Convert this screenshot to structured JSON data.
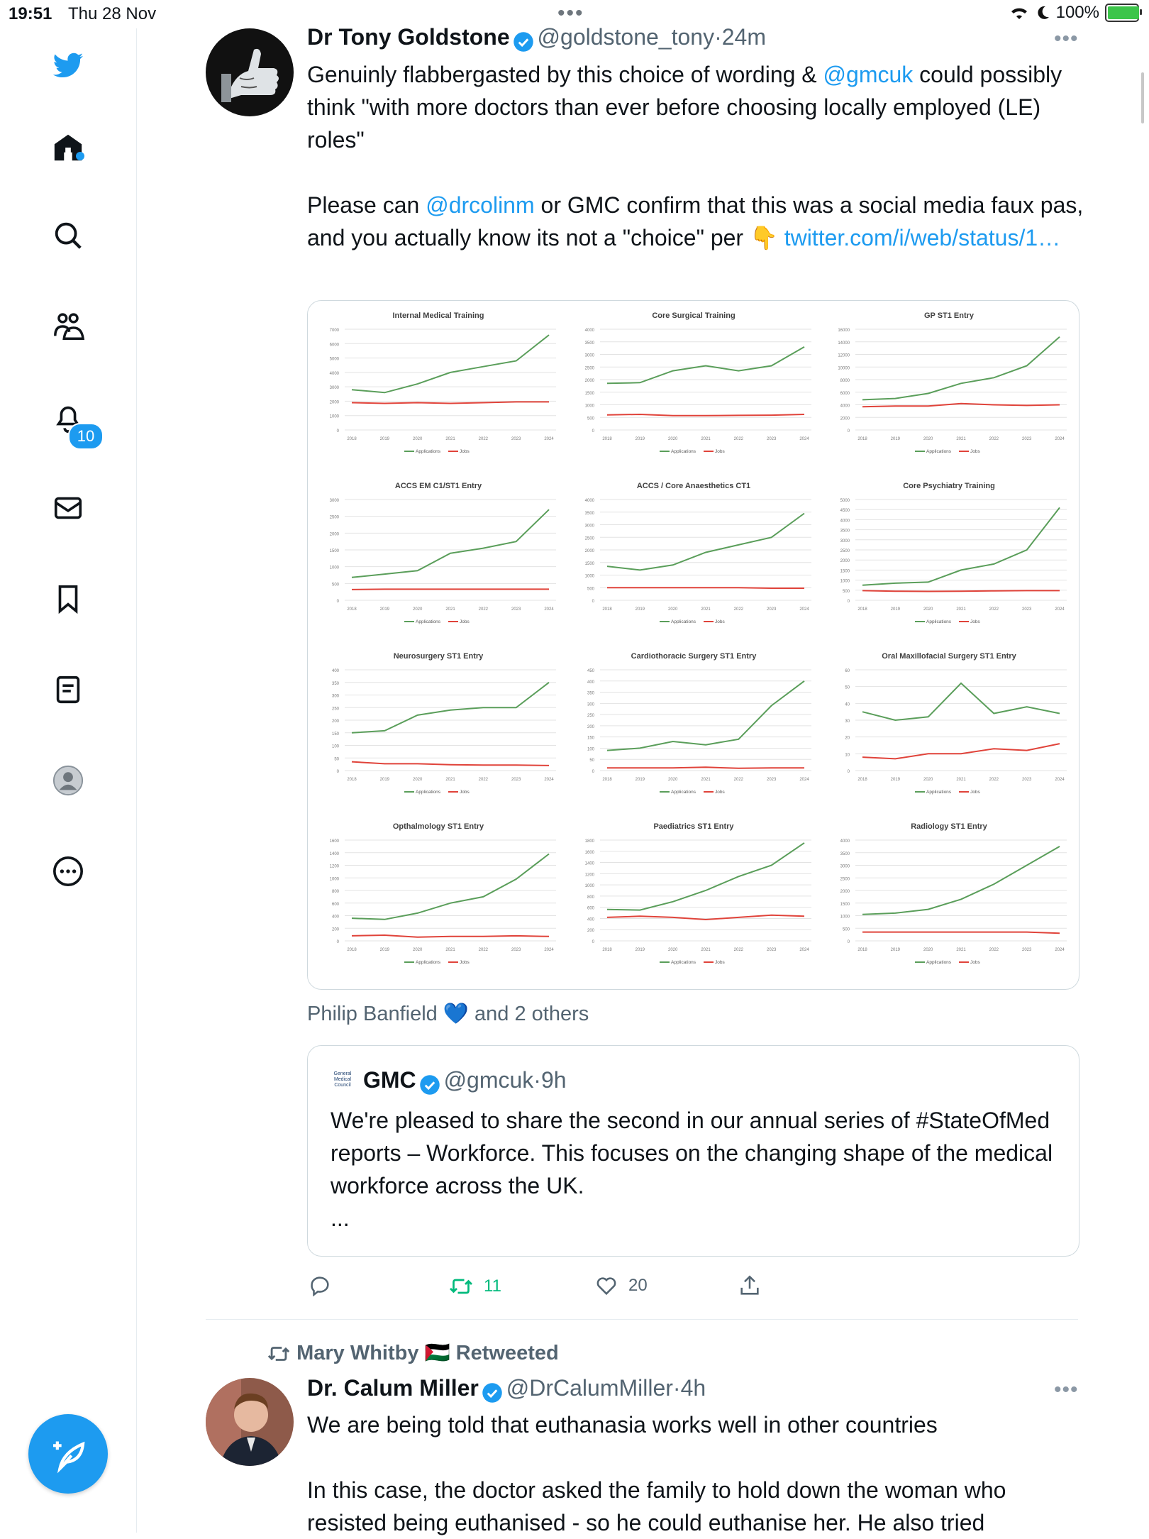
{
  "status": {
    "time": "19:51",
    "date": "Thu 28 Nov",
    "battery": "100%",
    "battery_level": 1.0
  },
  "sidebar": {
    "notif_count": "10"
  },
  "tweet1": {
    "name": "Dr Tony Goldstone",
    "handle": "@goldstone_tony",
    "dot": "·",
    "time": "24m",
    "line1_pre": "Genuinly flabbergasted by this choice of wording & ",
    "mention1": "@gmcuk",
    "line1_post": " could possibly think \"with more doctors than ever before choosing locally employed (LE)  roles\"",
    "line2_pre": "Please can ",
    "mention2": "@drcolinm",
    "line2_mid": " or GMC confirm that this was a social media faux pas, and you actually know its not a \"choice\" per ",
    "emoji": "👇",
    "link": "twitter.com/i/web/status/1…",
    "liked_by": "Philip Banfield",
    "heart": "💙",
    "liked_others": "and 2 others",
    "retweets": "11",
    "likes": "20"
  },
  "quote": {
    "logo_lines": [
      "General",
      "Medical",
      "Council"
    ],
    "name": "GMC",
    "handle": "@gmcuk",
    "dot": "·",
    "time": "9h",
    "text": "We're pleased to share the second in our annual series of #StateOfMed reports – Workforce. This focuses on the changing shape of the medical workforce across the UK.",
    "ellipsis": "..."
  },
  "tweet2": {
    "retweeter": "Mary Whitby",
    "flag": "🇵🇸",
    "retweeted": "Retweeted",
    "name": "Dr. Calum Miller",
    "handle": "@DrCalumMiller",
    "dot": "·",
    "time": "4h",
    "p1": "We are being told that euthanasia works well in other countries",
    "p2": "In this case, the doctor asked the family to hold down the woman who resisted being euthanised - so he could euthanise her. He also tried"
  },
  "colors": {
    "accent": "#1d9bf0",
    "applications": "#5a9e5a",
    "jobs": "#e0433a"
  },
  "chart_data": [
    {
      "type": "line",
      "title": "Internal Medical Training",
      "x": [
        "2018",
        "2019",
        "2020",
        "2021",
        "2022",
        "2023",
        "2024"
      ],
      "ylim": [
        0,
        7000
      ],
      "yticks": [
        "0",
        "1000",
        "2000",
        "3000",
        "4000",
        "5000",
        "6000",
        "7000"
      ],
      "series": [
        {
          "name": "Applications",
          "values": [
            2800,
            2600,
            3200,
            4000,
            4400,
            4800,
            6600
          ]
        },
        {
          "name": "Jobs",
          "values": [
            1900,
            1850,
            1900,
            1850,
            1900,
            1950,
            1950
          ]
        }
      ]
    },
    {
      "type": "line",
      "title": "Core Surgical Training",
      "x": [
        "2018",
        "2019",
        "2020",
        "2021",
        "2022",
        "2023",
        "2024"
      ],
      "ylim": [
        0,
        4000
      ],
      "yticks": [
        "0",
        "500",
        "1000",
        "1500",
        "2000",
        "2500",
        "3000",
        "3500",
        "4000"
      ],
      "series": [
        {
          "name": "Applications",
          "values": [
            1850,
            1880,
            2350,
            2550,
            2350,
            2550,
            3300
          ]
        },
        {
          "name": "Jobs",
          "values": [
            600,
            620,
            570,
            570,
            580,
            590,
            620
          ]
        }
      ]
    },
    {
      "type": "line",
      "title": "GP ST1 Entry",
      "x": [
        "2018",
        "2019",
        "2020",
        "2021",
        "2022",
        "2023",
        "2024"
      ],
      "ylim": [
        0,
        16000
      ],
      "yticks": [
        "0",
        "2000",
        "4000",
        "6000",
        "8000",
        "10000",
        "12000",
        "14000",
        "16000"
      ],
      "series": [
        {
          "name": "Applications",
          "values": [
            4800,
            5000,
            5800,
            7400,
            8300,
            10200,
            14800
          ]
        },
        {
          "name": "Jobs",
          "values": [
            3700,
            3800,
            3800,
            4200,
            4000,
            3900,
            4000
          ]
        }
      ]
    },
    {
      "type": "line",
      "title": "ACCS EM C1/ST1 Entry",
      "x": [
        "2018",
        "2019",
        "2020",
        "2021",
        "2022",
        "2023",
        "2024"
      ],
      "ylim": [
        0,
        3000
      ],
      "yticks": [
        "0",
        "500",
        "1000",
        "1500",
        "2000",
        "2500",
        "3000"
      ],
      "series": [
        {
          "name": "Applications",
          "values": [
            680,
            780,
            880,
            1400,
            1550,
            1750,
            2700
          ]
        },
        {
          "name": "Jobs",
          "values": [
            320,
            330,
            330,
            330,
            330,
            330,
            330
          ]
        }
      ]
    },
    {
      "type": "line",
      "title": "ACCS / Core Anaesthetics CT1",
      "x": [
        "2018",
        "2019",
        "2020",
        "2021",
        "2022",
        "2023",
        "2024"
      ],
      "ylim": [
        0,
        4000
      ],
      "yticks": [
        "0",
        "500",
        "1000",
        "1500",
        "2000",
        "2500",
        "3000",
        "3500",
        "4000"
      ],
      "series": [
        {
          "name": "Applications",
          "values": [
            1350,
            1200,
            1400,
            1900,
            2200,
            2500,
            3450
          ]
        },
        {
          "name": "Jobs",
          "values": [
            500,
            500,
            500,
            500,
            500,
            480,
            480
          ]
        }
      ]
    },
    {
      "type": "line",
      "title": "Core Psychiatry Training",
      "x": [
        "2018",
        "2019",
        "2020",
        "2021",
        "2022",
        "2023",
        "2024"
      ],
      "ylim": [
        0,
        5000
      ],
      "yticks": [
        "0",
        "500",
        "1000",
        "1500",
        "2000",
        "2500",
        "3000",
        "3500",
        "4000",
        "4500",
        "5000"
      ],
      "series": [
        {
          "name": "Applications",
          "values": [
            750,
            850,
            900,
            1500,
            1800,
            2500,
            4600
          ]
        },
        {
          "name": "Jobs",
          "values": [
            480,
            450,
            440,
            450,
            470,
            480,
            480
          ]
        }
      ]
    },
    {
      "type": "line",
      "title": "Neurosurgery ST1 Entry",
      "x": [
        "2018",
        "2019",
        "2020",
        "2021",
        "2022",
        "2023",
        "2024"
      ],
      "ylim": [
        0,
        400
      ],
      "yticks": [
        "0",
        "50",
        "100",
        "150",
        "200",
        "250",
        "300",
        "350",
        "400"
      ],
      "series": [
        {
          "name": "Applications",
          "values": [
            150,
            158,
            220,
            240,
            250,
            250,
            350
          ]
        },
        {
          "name": "Jobs",
          "values": [
            35,
            27,
            27,
            23,
            22,
            22,
            20
          ]
        }
      ]
    },
    {
      "type": "line",
      "title": "Cardiothoracic Surgery ST1 Entry",
      "x": [
        "2018",
        "2019",
        "2020",
        "2021",
        "2022",
        "2023",
        "2024"
      ],
      "ylim": [
        0,
        450
      ],
      "yticks": [
        "0",
        "50",
        "100",
        "150",
        "200",
        "250",
        "300",
        "350",
        "400",
        "450"
      ],
      "series": [
        {
          "name": "Applications",
          "values": [
            90,
            100,
            130,
            115,
            140,
            290,
            400
          ]
        },
        {
          "name": "Jobs",
          "values": [
            12,
            12,
            12,
            15,
            10,
            12,
            12
          ]
        }
      ]
    },
    {
      "type": "line",
      "title": "Oral Maxillofacial Surgery ST1 Entry",
      "x": [
        "2018",
        "2019",
        "2020",
        "2021",
        "2022",
        "2023",
        "2024"
      ],
      "ylim": [
        0,
        60
      ],
      "yticks": [
        "0",
        "10",
        "20",
        "30",
        "40",
        "50",
        "60"
      ],
      "series": [
        {
          "name": "Applications",
          "values": [
            35,
            30,
            32,
            52,
            34,
            38,
            34
          ]
        },
        {
          "name": "Jobs",
          "values": [
            8,
            7,
            10,
            10,
            13,
            12,
            16
          ]
        }
      ]
    },
    {
      "type": "line",
      "title": "Opthalmology ST1 Entry",
      "x": [
        "2018",
        "2019",
        "2020",
        "2021",
        "2022",
        "2023",
        "2024"
      ],
      "ylim": [
        0,
        1600
      ],
      "yticks": [
        "0",
        "200",
        "400",
        "600",
        "800",
        "1000",
        "1200",
        "1400",
        "1600"
      ],
      "series": [
        {
          "name": "Applications",
          "values": [
            360,
            340,
            440,
            600,
            700,
            980,
            1380
          ]
        },
        {
          "name": "Jobs",
          "values": [
            80,
            90,
            60,
            70,
            70,
            80,
            70
          ]
        }
      ]
    },
    {
      "type": "line",
      "title": "Paediatrics ST1 Entry",
      "x": [
        "2018",
        "2019",
        "2020",
        "2021",
        "2022",
        "2023",
        "2024"
      ],
      "ylim": [
        0,
        1800
      ],
      "yticks": [
        "0",
        "200",
        "400",
        "600",
        "800",
        "1000",
        "1200",
        "1400",
        "1600",
        "1800"
      ],
      "series": [
        {
          "name": "Applications",
          "values": [
            560,
            550,
            700,
            900,
            1150,
            1350,
            1750
          ]
        },
        {
          "name": "Jobs",
          "values": [
            420,
            440,
            420,
            380,
            420,
            460,
            440
          ]
        }
      ]
    },
    {
      "type": "line",
      "title": "Radiology ST1 Entry",
      "x": [
        "2018",
        "2019",
        "2020",
        "2021",
        "2022",
        "2023",
        "2024"
      ],
      "ylim": [
        0,
        4000
      ],
      "yticks": [
        "0",
        "500",
        "1000",
        "1500",
        "2000",
        "2500",
        "3000",
        "3500",
        "4000"
      ],
      "series": [
        {
          "name": "Applications",
          "values": [
            1050,
            1100,
            1250,
            1650,
            2250,
            3000,
            3750
          ]
        },
        {
          "name": "Jobs",
          "values": [
            350,
            350,
            350,
            350,
            350,
            350,
            300
          ]
        }
      ]
    }
  ]
}
